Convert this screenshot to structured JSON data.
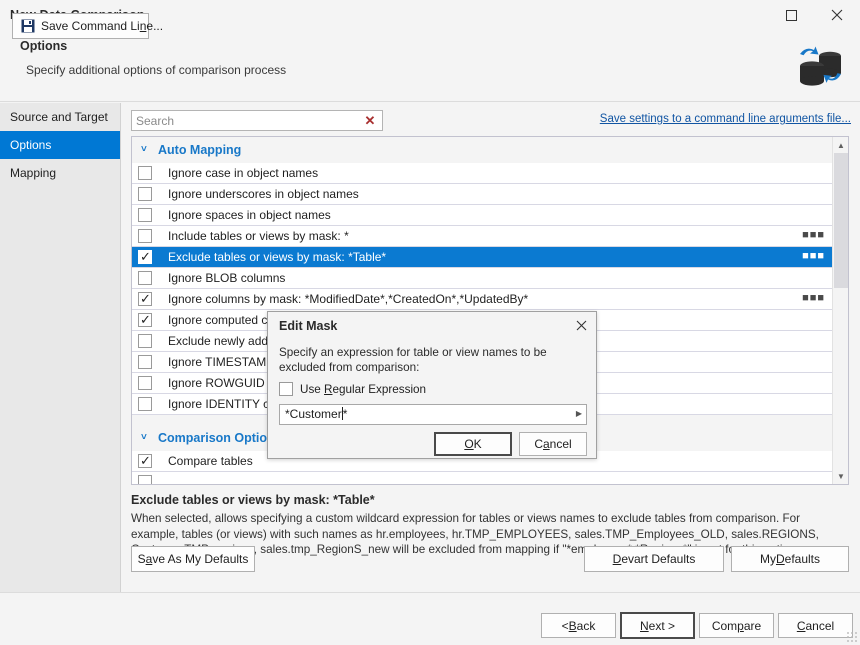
{
  "window": {
    "title": "New Data Comparison",
    "maximize_icon": "maximize-icon",
    "close_icon": "close-icon"
  },
  "header": {
    "title": "Options",
    "subtitle": "Specify additional options of comparison process",
    "logo_icon": "database-sync-logo"
  },
  "sidebar": {
    "items": [
      {
        "label": "Source and Target",
        "active": false
      },
      {
        "label": "Options",
        "active": true
      },
      {
        "label": "Mapping",
        "active": false
      }
    ]
  },
  "search": {
    "value": "",
    "placeholder": "Search",
    "clear_icon": "clear-x-icon"
  },
  "save_settings_link": "Save settings to a command line arguments file...",
  "options_list": {
    "groups": [
      {
        "name": "Auto Mapping",
        "chevron": "˅",
        "rows": [
          {
            "label": "Ignore case in object names",
            "checked": false,
            "selected": false,
            "ellipsis": false
          },
          {
            "label": "Ignore underscores in object names",
            "checked": false,
            "selected": false,
            "ellipsis": false
          },
          {
            "label": "Ignore spaces in object names",
            "checked": false,
            "selected": false,
            "ellipsis": false
          },
          {
            "label": "Include tables or views by mask: *",
            "checked": false,
            "selected": false,
            "ellipsis": true
          },
          {
            "label": "Exclude tables or views by mask: *Table*",
            "checked": true,
            "selected": true,
            "ellipsis": true
          },
          {
            "label": "Ignore BLOB columns",
            "checked": false,
            "selected": false,
            "ellipsis": false
          },
          {
            "label": "Ignore columns by mask: *ModifiedDate*,*CreatedOn*,*UpdatedBy*",
            "checked": true,
            "selected": false,
            "ellipsis": true
          },
          {
            "label": "Ignore computed columns",
            "checked": true,
            "selected": false,
            "ellipsis": false
          },
          {
            "label": "Exclude newly added objects",
            "checked": false,
            "selected": false,
            "ellipsis": false
          },
          {
            "label": "Ignore TIMESTAMP columns",
            "checked": false,
            "selected": false,
            "ellipsis": false
          },
          {
            "label": "Ignore ROWGUID columns",
            "checked": false,
            "selected": false,
            "ellipsis": false
          },
          {
            "label": "Ignore IDENTITY columns",
            "checked": false,
            "selected": false,
            "ellipsis": false
          }
        ]
      },
      {
        "name": "Comparison Options",
        "chevron": "˅",
        "rows": [
          {
            "label": "Compare tables",
            "checked": true,
            "selected": false,
            "ellipsis": false
          },
          {
            "label": "",
            "checked": false,
            "selected": false,
            "ellipsis": false
          }
        ]
      }
    ],
    "scroll_up_icon": "scroll-up-arrow-icon",
    "scroll_down_icon": "scroll-down-arrow-icon"
  },
  "description": {
    "title": "Exclude tables or views by mask: *Table*",
    "body": "When selected, allows specifying a custom wildcard expression for tables or views names to exclude tables from comparison. For example, tables (or views) with such names as hr.employees, hr.TMP_EMPLOYEES, sales.TMP_Employees_OLD, sales.REGIONS, Customer.TMP_regions, sales.tmp_RegionS_new will be excluded from mapping if \"*employees*,*Regions*\" is set for this option."
  },
  "defaults_buttons": {
    "save_as_my_defaults": {
      "pre": "S",
      "underline": "a",
      "post": "ve As My Defaults"
    },
    "devart_defaults": {
      "pre": "",
      "underline": "D",
      "post": "evart Defaults"
    },
    "my_defaults": {
      "pre": "My ",
      "underline": "D",
      "post": "efaults"
    }
  },
  "footer": {
    "save_command_line": {
      "pre": "Save Command Li",
      "underline": "n",
      "post": "e..."
    },
    "save_icon": "floppy-disk-icon",
    "back": {
      "pre": "< ",
      "underline": "B",
      "post": "ack"
    },
    "next": {
      "pre": "",
      "underline": "N",
      "post": "ext >"
    },
    "compare": {
      "pre": "Com",
      "underline": "p",
      "post": "are"
    },
    "cancel": {
      "pre": "",
      "underline": "C",
      "post": "ancel"
    },
    "resize_grip_icon": "resize-grip-icon"
  },
  "modal": {
    "title": "Edit Mask",
    "close_icon": "close-icon",
    "description": "Specify an expression for table or view names to be excluded from comparison:",
    "regex_checkbox": {
      "checked": false,
      "pre": "Use ",
      "underline": "R",
      "post": "egular Expression"
    },
    "input": {
      "value_before_caret": "*Customer",
      "value_after_caret": "*",
      "dropdown_icon": "dropdown-arrow-icon"
    },
    "ok": {
      "pre": "",
      "underline": "O",
      "post": "K"
    },
    "cancel": {
      "pre": "C",
      "underline": "a",
      "post": "ncel"
    }
  },
  "colors": {
    "accent_blue": "#0078d4",
    "selection_blue": "#0b7ad1",
    "link_blue": "#1155a3",
    "group_header_blue": "#1878c8",
    "window_bg": "#f4f4f4",
    "clear_red": "#a82f2f"
  }
}
